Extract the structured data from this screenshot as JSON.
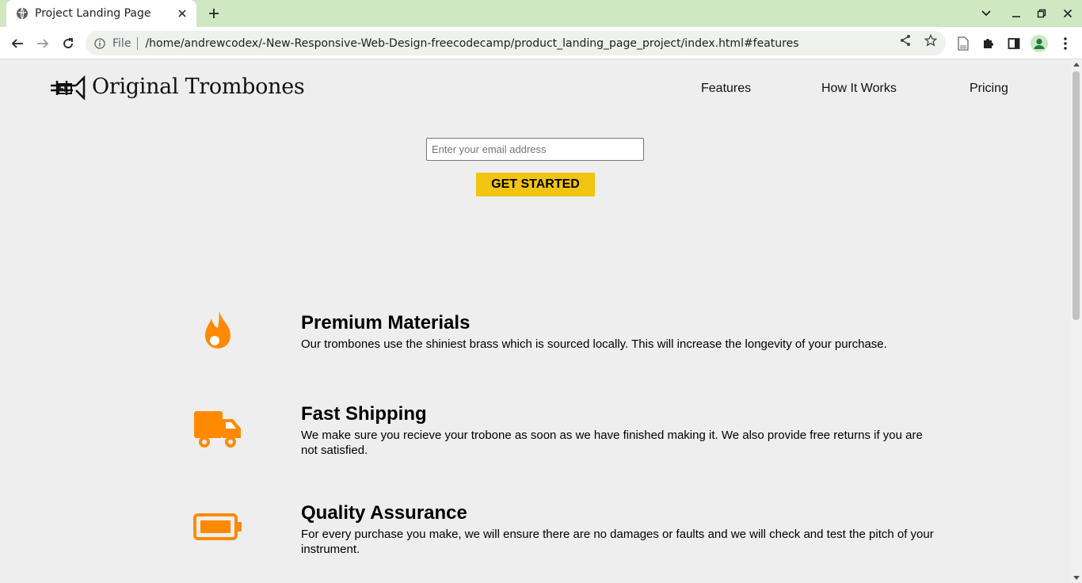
{
  "browser": {
    "tab_title": "Project Landing Page",
    "url_chip": "File",
    "url": "/home/andrewcodex/-New-Responsive-Web-Design-freecodecamp/product_landing_page_project/index.html#features",
    "icons": [
      "globe-icon",
      "close-icon",
      "plus-icon",
      "chevron-down-icon",
      "minimize-icon",
      "restore-icon",
      "window-close-icon",
      "back-arrow-icon",
      "forward-arrow-icon",
      "reload-icon",
      "info-icon",
      "share-icon",
      "star-icon",
      "page-icon",
      "puzzle-icon",
      "side-panel-icon",
      "profile-icon",
      "kebab-menu-icon"
    ]
  },
  "header": {
    "brand": "Original Trombones",
    "nav": [
      "Features",
      "How It Works",
      "Pricing"
    ]
  },
  "form": {
    "email_placeholder": "Enter your email address",
    "email_value": "",
    "submit_label": "GET STARTED"
  },
  "features": [
    {
      "title": "Premium Materials",
      "text": "Our trombones use the shiniest brass which is sourced locally. This will increase the longevity of your purchase.",
      "icon": "fire-icon"
    },
    {
      "title": "Fast Shipping",
      "text": "We make sure you recieve your trobone as soon as we have finished making it. We also provide free returns if you are not satisfied.",
      "icon": "truck-icon"
    },
    {
      "title": "Quality Assurance",
      "text": "For every purchase you make, we will ensure there are no damages or faults and we will check and test the pitch of your instrument.",
      "icon": "battery-icon"
    }
  ],
  "colors": {
    "accent": "#ff8a00",
    "cta": "#f1c40f",
    "background": "#eeeeee",
    "tabstrip": "#cfe8c2"
  }
}
